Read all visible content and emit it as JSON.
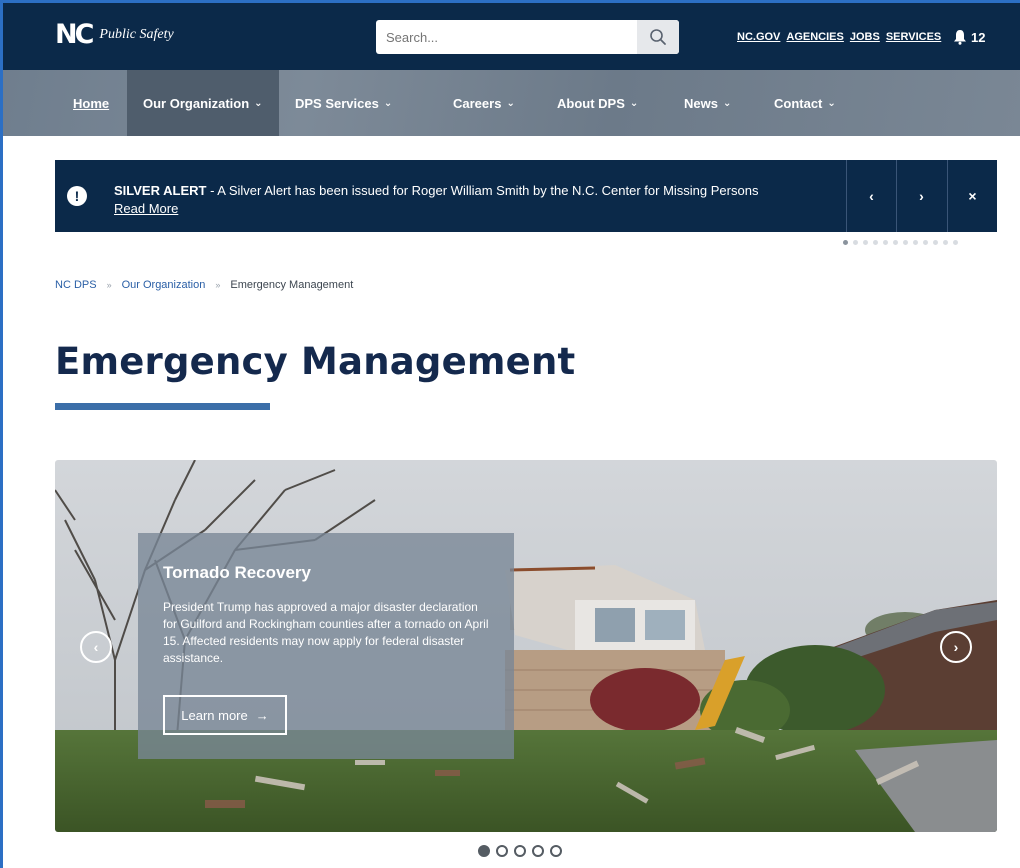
{
  "header": {
    "logo_mark": "NC",
    "logo_text": "Public Safety",
    "search_placeholder": "Search...",
    "util_links": [
      "NC.GOV",
      "AGENCIES",
      "JOBS",
      "SERVICES"
    ],
    "notification_count": "12"
  },
  "nav": {
    "items": [
      {
        "label": "Home"
      },
      {
        "label": "Our Organization"
      },
      {
        "label": "DPS Services"
      },
      {
        "label": "Careers"
      },
      {
        "label": "About DPS"
      },
      {
        "label": "News"
      },
      {
        "label": "Contact"
      }
    ]
  },
  "alert": {
    "title": "SILVER ALERT",
    "message": " - A Silver Alert has been issued for Roger William Smith by the N.C. Center for Missing Persons",
    "link": "Read More",
    "prev_symbol": "‹",
    "next_symbol": "›",
    "close_symbol": "×",
    "dot_count": 12
  },
  "breadcrumb": {
    "items": [
      "NC DPS",
      "Our Organization"
    ],
    "current": "Emergency Management"
  },
  "page": {
    "title": "Emergency Management"
  },
  "hero": {
    "title": "Tornado Recovery",
    "description": "President Trump has approved a major disaster declaration for Guilford and Rockingham counties after a tornado on April 15. Affected residents may now apply for federal disaster assistance.",
    "button_label": "Learn more",
    "slide_count": 5,
    "active_slide": 1
  },
  "colors": {
    "header_bg": "#0b2949",
    "nav_bg": "#75838f",
    "accent": "#3b6ea8",
    "title": "#14294d"
  }
}
